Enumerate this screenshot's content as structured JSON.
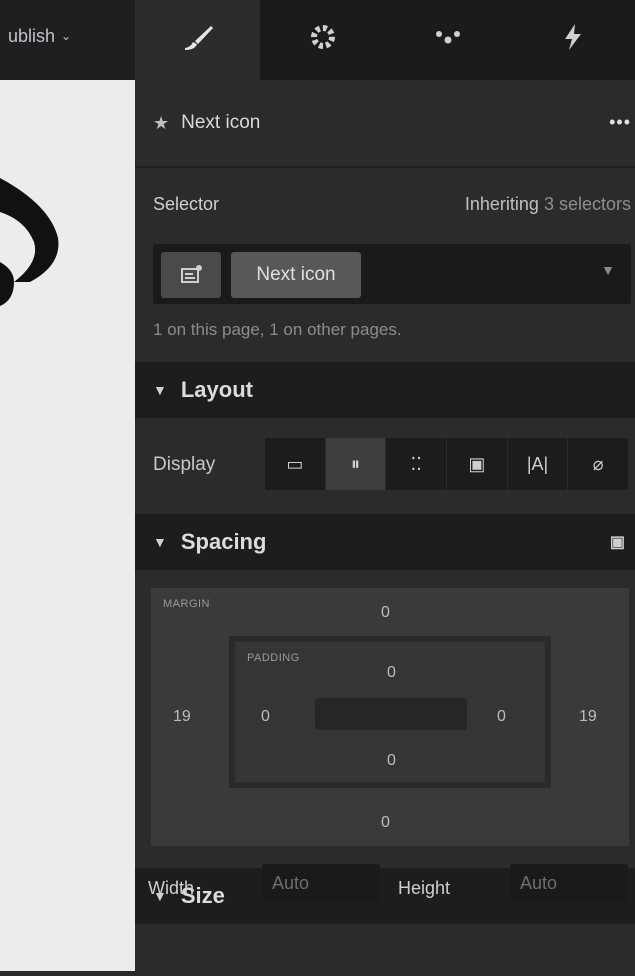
{
  "topbar": {
    "publish_label": "ublish",
    "publish_chev": "⌄"
  },
  "tabs": [
    {
      "icon": "brush-icon",
      "glyph": "🖌"
    },
    {
      "icon": "gear-icon",
      "glyph": "⚙"
    },
    {
      "icon": "drops-icon",
      "glyph": "💧"
    },
    {
      "icon": "lightning-icon",
      "glyph": "⚡"
    }
  ],
  "element": {
    "star": "★",
    "name": "Next icon",
    "more": "•••"
  },
  "selector": {
    "label": "Selector",
    "inheriting_prefix": "Inheriting ",
    "inheriting_count": "3 selectors",
    "chip_label": "Next icon",
    "page_info": "1 on this page, 1 on other pages."
  },
  "layout": {
    "title": "Layout",
    "display_label": "Display",
    "display_options": [
      "▭",
      "⏸",
      "⁚⁚",
      "▣",
      "|A|",
      "⌀"
    ]
  },
  "spacing": {
    "title": "Spacing",
    "margin_label": "MARGIN",
    "padding_label": "PADDING",
    "margin": {
      "top": "0",
      "right": "19",
      "bottom": "0",
      "left": "19"
    },
    "padding": {
      "top": "0",
      "right": "0",
      "bottom": "0",
      "left": "0"
    }
  },
  "size": {
    "title": "Size",
    "width_label": "Width",
    "height_label": "Height",
    "width_value": "Auto",
    "height_value": "Auto"
  },
  "colors": {
    "panel": "#2b2b2d",
    "canvas": "#ebecee",
    "topbar": "#1f1f21"
  }
}
